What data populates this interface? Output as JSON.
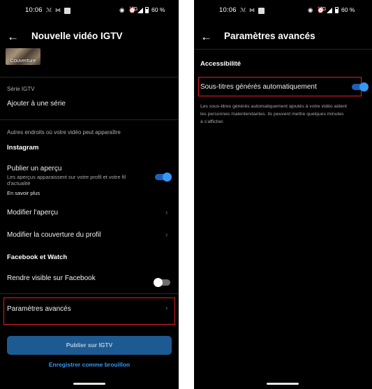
{
  "left": {
    "status": {
      "time": "10:06",
      "network": "4G",
      "battery": "60 %"
    },
    "header": {
      "title": "Nouvelle vidéo IGTV"
    },
    "cover_label": "Couverture",
    "series": {
      "section": "Série IGTV",
      "add": "Ajouter à une série"
    },
    "other_places": {
      "section": "Autres endroits où votre vidéo peut apparaître"
    },
    "instagram": {
      "title": "Instagram",
      "preview_title": "Publier un aperçu",
      "preview_desc_line1": "Les aperçus apparaissent sur votre profil et votre fil",
      "preview_desc_line2": "d'actualité",
      "learn_more": "En savoir plus",
      "preview_on": true,
      "modify_preview": "Modifier l'aperçu",
      "modify_cover": "Modifier la couverture du profil"
    },
    "facebook": {
      "title": "Facebook et Watch",
      "visible": "Rendre visible sur Facebook",
      "visible_on": false
    },
    "advanced": "Paramètres avancés",
    "publish_button": "Publier sur IGTV",
    "draft_link": "Enregistrer comme brouillon"
  },
  "right": {
    "status": {
      "time": "10:06",
      "network": "4G",
      "battery": "60 %"
    },
    "header": {
      "title": "Paramètres avancés"
    },
    "accessibility": {
      "title": "Accessibilité",
      "auto_captions": "Sous-titres générés automatiquement",
      "auto_captions_on": true,
      "desc_line1": "Les sous-titres générés automatiquement ajoutés à votre vidéo aident",
      "desc_line2": "les personnes malentendantes. Ils peuvent mettre quelques minutes",
      "desc_line3": "à s'afficher."
    }
  },
  "colors": {
    "background": "#000000",
    "accent": "#3897f0",
    "highlight_box": "#e02020",
    "publish_button": "#1e5a92"
  },
  "icons": [
    "back-arrow-icon",
    "chevron-right-icon",
    "signal-icon",
    "battery-icon",
    "eye-icon",
    "alarm-icon",
    "gmail-icon",
    "gallery-icon"
  ]
}
